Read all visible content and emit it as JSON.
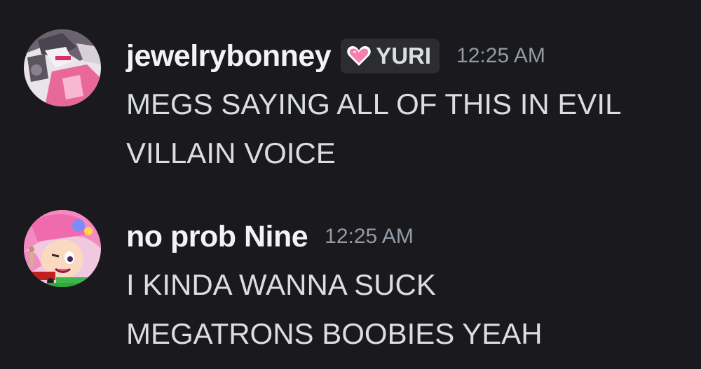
{
  "messages": [
    {
      "username": "jewelrybonney",
      "role_tag": {
        "icon": "pink-heart-icon",
        "label": "YURI",
        "color": "#f47fb0"
      },
      "timestamp": "12:25 AM",
      "lines": [
        "MEGS SAYING ALL OF THIS IN EVIL",
        "VILLAIN VOICE"
      ]
    },
    {
      "username": "no prob Nine",
      "timestamp": "12:25 AM",
      "lines": [
        "I KINDA WANNA SUCK",
        "MEGATRONS BOOBIES YEAH"
      ]
    }
  ],
  "colors": {
    "background": "#1a1a1e",
    "username": "#f2f3f5",
    "timestamp": "#949ba4",
    "message_text": "#dbdee1",
    "role_tag_bg": "#2b2d31"
  }
}
